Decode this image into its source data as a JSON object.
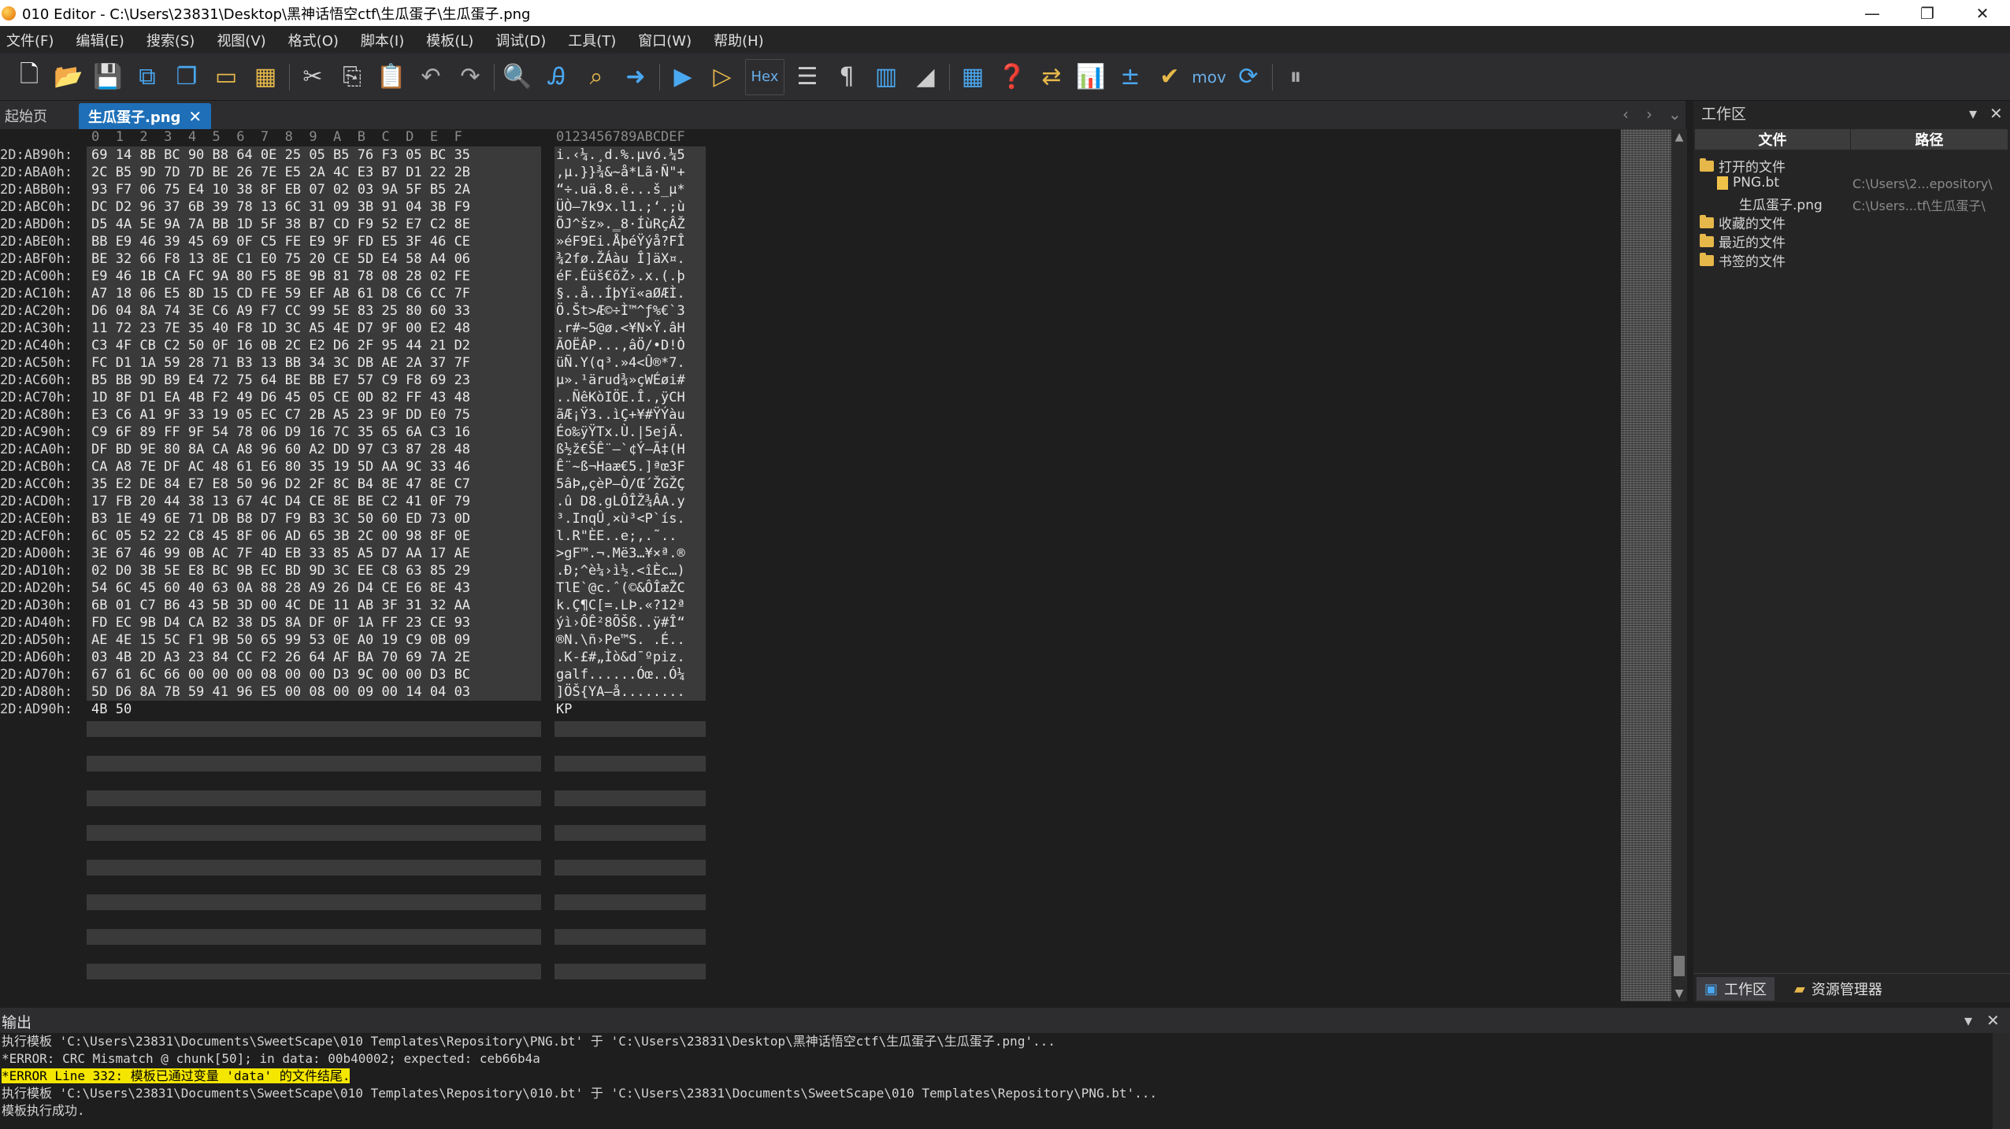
{
  "window": {
    "title": "010 Editor - C:\\Users\\23831\\Desktop\\黑神话悟空ctf\\生瓜蛋子\\生瓜蛋子.png",
    "minimize": "—",
    "restore": "❐",
    "close": "✕"
  },
  "menu": [
    "文件(F)",
    "编辑(E)",
    "搜索(S)",
    "视图(V)",
    "格式(O)",
    "脚本(I)",
    "模板(L)",
    "调试(D)",
    "工具(T)",
    "窗口(W)",
    "帮助(H)"
  ],
  "toolbar": {
    "hex_label": "Hex",
    "mov_label": "mov",
    "icons": [
      "new-file-icon",
      "open-file-icon",
      "save-icon",
      "save-as-icon",
      "save-all-icon",
      "open-folder-icon",
      "workspace-icon",
      "cut-icon",
      "copy-icon",
      "paste-icon",
      "undo-icon",
      "redo-icon",
      "find-icon",
      "replace-icon",
      "find-in-files-icon",
      "goto-icon",
      "run-script-icon",
      "run-template-icon",
      "hex-mode",
      "edit-as-icon",
      "pilcrow-icon",
      "columns-icon",
      "highlight-icon",
      "calculator-icon",
      "inspector-icon",
      "compare-icon",
      "histogram-icon",
      "checksum-icon",
      "verify-icon",
      "mov-label",
      "base-convert-icon",
      "pause-icon"
    ]
  },
  "tabs": {
    "home": "起始页",
    "active": "生瓜蛋子.png",
    "close": "✕"
  },
  "hex_header": {
    "columns": "0  1  2  3  4  5  6  7  8  9  A  B  C  D  E  F",
    "ascii": "0123456789ABCDEF"
  },
  "hex_rows": [
    {
      "addr": "2D:AB90h:",
      "hex": "69 14 8B BC 90 B8 64 0E 25 05 B5 76 F3 05 BC 35",
      "ascii": "i.‹¼.¸d.%.µvó.¼5"
    },
    {
      "addr": "2D:ABA0h:",
      "hex": "2C B5 9D 7D 7D BE 26 7E E5 2A 4C E3 B7 D1 22 2B",
      "ascii": ",µ.}}¾&~å*Lã·Ñ\"+"
    },
    {
      "addr": "2D:ABB0h:",
      "hex": "93 F7 06 75 E4 10 38 8F EB 07 02 03 9A 5F B5 2A",
      "ascii": "“÷.uä.8.ë...š_µ*"
    },
    {
      "addr": "2D:ABC0h:",
      "hex": "DC D2 96 37 6B 39 78 13 6C 31 09 3B 91 04 3B F9",
      "ascii": "ÜÒ–7k9x.l1.;‘.;ù"
    },
    {
      "addr": "2D:ABD0h:",
      "hex": "D5 4A 5E 9A 7A BB 1D 5F 38 B7 CD F9 52 E7 C2 8E",
      "ascii": "ÕJ^šz».‗8·ÍùRçÂŽ"
    },
    {
      "addr": "2D:ABE0h:",
      "hex": "BB E9 46 39 45 69 0F C5 FE E9 9F FD E5 3F 46 CE",
      "ascii": "»éF9Ei.ÅþéŸýå?FÎ"
    },
    {
      "addr": "2D:ABF0h:",
      "hex": "BE 32 66 F8 13 8E C1 E0 75 20 CE 5D E4 58 A4 06",
      "ascii": "¾2fø.ŽÁàu Î]äX¤."
    },
    {
      "addr": "2D:AC00h:",
      "hex": "E9 46 1B CA FC 9A 80 F5 8E 9B 81 78 08 28 02 FE",
      "ascii": "éF.Êüš€õŽ›.x.(.þ"
    },
    {
      "addr": "2D:AC10h:",
      "hex": "A7 18 06 E5 8D 15 CD FE 59 EF AB 61 D8 C6 CC 7F",
      "ascii": "§..å..ÍþYï«aØÆÌ."
    },
    {
      "addr": "2D:AC20h:",
      "hex": "D6 04 8A 74 3E C6 A9 F7 CC 99 5E 83 25 80 60 33",
      "ascii": "Ö.Št>Æ©÷Ì™^ƒ%€`3"
    },
    {
      "addr": "2D:AC30h:",
      "hex": "11 72 23 7E 35 40 F8 1D 3C A5 4E D7 9F 00 E2 48",
      "ascii": ".r#~5@ø.<¥N×Ÿ.âH"
    },
    {
      "addr": "2D:AC40h:",
      "hex": "C3 4F CB C2 50 0F 16 0B 2C E2 D6 2F 95 44 21 D2",
      "ascii": "ÃOËÂP...,âÖ/•D!Ò"
    },
    {
      "addr": "2D:AC50h:",
      "hex": "FC D1 1A 59 28 71 B3 13 BB 34 3C DB AE 2A 37 7F",
      "ascii": "üÑ.Y(q³.»4<Û®*7."
    },
    {
      "addr": "2D:AC60h:",
      "hex": "B5 BB 9D B9 E4 72 75 64 BE BB E7 57 C9 F8 69 23",
      "ascii": "µ».¹ärud¾»çWÉøi#"
    },
    {
      "addr": "2D:AC70h:",
      "hex": "1D 8F D1 EA 4B F2 49 D6 45 05 CE 0D 82 FF 43 48",
      "ascii": "..ÑêKòIÖE.Î.‚ÿCH"
    },
    {
      "addr": "2D:AC80h:",
      "hex": "E3 C6 A1 9F 33 19 05 EC C7 2B A5 23 9F DD E0 75",
      "ascii": "ãÆ¡Ÿ3..ìÇ+¥#ŸÝàu"
    },
    {
      "addr": "2D:AC90h:",
      "hex": "C9 6F 89 FF 9F 54 78 06 D9 16 7C 35 65 6A C3 16",
      "ascii": "Éo‰ÿŸTx.Ù.|5ejÃ."
    },
    {
      "addr": "2D:ACA0h:",
      "hex": "DF BD 9E 80 8A CA A8 96 60 A2 DD 97 C3 87 28 48",
      "ascii": "ß½ž€ŠÊ¨–`¢Ý—Ã‡(H"
    },
    {
      "addr": "2D:ACB0h:",
      "hex": "CA A8 7E DF AC 48 61 E6 80 35 19 5D AA 9C 33 46",
      "ascii": "Ê¨~ß¬Haæ€5.]ªœ3F"
    },
    {
      "addr": "2D:ACC0h:",
      "hex": "35 E2 DE 84 E7 E8 50 96 D2 2F 8C B4 8E 47 8E C7",
      "ascii": "5âÞ„çèP–Ò/Œ´ŽGŽÇ"
    },
    {
      "addr": "2D:ACD0h:",
      "hex": "17 FB 20 44 38 13 67 4C D4 CE 8E BE C2 41 0F 79",
      "ascii": ".û D8.gLÔÎŽ¾ÂA.y"
    },
    {
      "addr": "2D:ACE0h:",
      "hex": "B3 1E 49 6E 71 DB B8 D7 F9 B3 3C 50 60 ED 73 0D",
      "ascii": "³.InqÛ¸×ù³<P`ís."
    },
    {
      "addr": "2D:ACF0h:",
      "hex": "6C 05 52 22 C8 45 8F 06 AD 65 3B 2C 00 98 8F 0E",
      "ascii": "l.R\"ÈE..­e;,.˜.."
    },
    {
      "addr": "2D:AD00h:",
      "hex": "3E 67 46 99 0B AC 7F 4D EB 33 85 A5 D7 AA 17 AE",
      "ascii": ">gF™.¬.Më3…¥×ª.®"
    },
    {
      "addr": "2D:AD10h:",
      "hex": "02 D0 3B 5E E8 BC 9B EC BD 9D 3C EE C8 63 85 29",
      "ascii": ".Ð;^è¼›ì½.<îÈc…)"
    },
    {
      "addr": "2D:AD20h:",
      "hex": "54 6C 45 60 40 63 0A 88 28 A9 26 D4 CE E6 8E 43",
      "ascii": "TlE`@c.ˆ(©&ÔÎæŽC"
    },
    {
      "addr": "2D:AD30h:",
      "hex": "6B 01 C7 B6 43 5B 3D 00 4C DE 11 AB 3F 31 32 AA",
      "ascii": "k.Ç¶C[=.LÞ.«?12ª"
    },
    {
      "addr": "2D:AD40h:",
      "hex": "FD EC 9B D4 CA B2 38 D5 8A DF 0F 1A FF 23 CE 93",
      "ascii": "ýì›ÔÊ²8ÕŠß..ÿ#Î“"
    },
    {
      "addr": "2D:AD50h:",
      "hex": "AE 4E 15 5C F1 9B 50 65 99 53 0E A0 19 C9 0B 09",
      "ascii": "®N.\\ñ›Pe™S. .É.."
    },
    {
      "addr": "2D:AD60h:",
      "hex": "03 4B 2D A3 23 84 CC F2 26 64 AF BA 70 69 7A 2E",
      "ascii": ".K-£#„Ìò&d¯ºpiz."
    },
    {
      "addr": "2D:AD70h:",
      "hex": "67 61 6C 66 00 00 00 08 00 00 D3 9C 00 00 D3 BC",
      "ascii": "galf......Óœ..Ó¼"
    },
    {
      "addr": "2D:AD80h:",
      "hex": "5D D6 8A 7B 59 41 96 E5 00 08 00 09 00 14 04 03",
      "ascii": "]ÖŠ{YA–å........"
    },
    {
      "addr": "2D:AD90h:",
      "hex": "4B 50",
      "ascii": "KP"
    }
  ],
  "workspace": {
    "title": "工作区",
    "col_file": "文件",
    "col_path": "路径",
    "open_files": "打开的文件",
    "file1": "PNG.bt",
    "file1_path": "C:\\Users\\2...epository\\",
    "file2": "生瓜蛋子.png",
    "file2_path": "C:\\Users...tf\\生瓜蛋子\\",
    "favorites": "收藏的文件",
    "recent": "最近的文件",
    "bookmarked": "书签的文件",
    "tab_workspace": "工作区",
    "tab_explorer": "资源管理器"
  },
  "output": {
    "title": "输出",
    "lines": [
      "执行模板 'C:\\Users\\23831\\Documents\\SweetScape\\010 Templates\\Repository\\PNG.bt' 于 'C:\\Users\\23831\\Desktop\\黑神话悟空ctf\\生瓜蛋子\\生瓜蛋子.png'...",
      "*ERROR: CRC Mismatch @ chunk[50]; in data: 00b40002; expected: ceb66b4a",
      "*ERROR Line 332: 模板已通过变量 'data' 的文件结尾.",
      "执行模板 'C:\\Users\\23831\\Documents\\SweetScape\\010 Templates\\Repository\\010.bt' 于 'C:\\Users\\23831\\Documents\\SweetScape\\010 Templates\\Repository\\PNG.bt'...",
      "模板执行成功."
    ]
  }
}
